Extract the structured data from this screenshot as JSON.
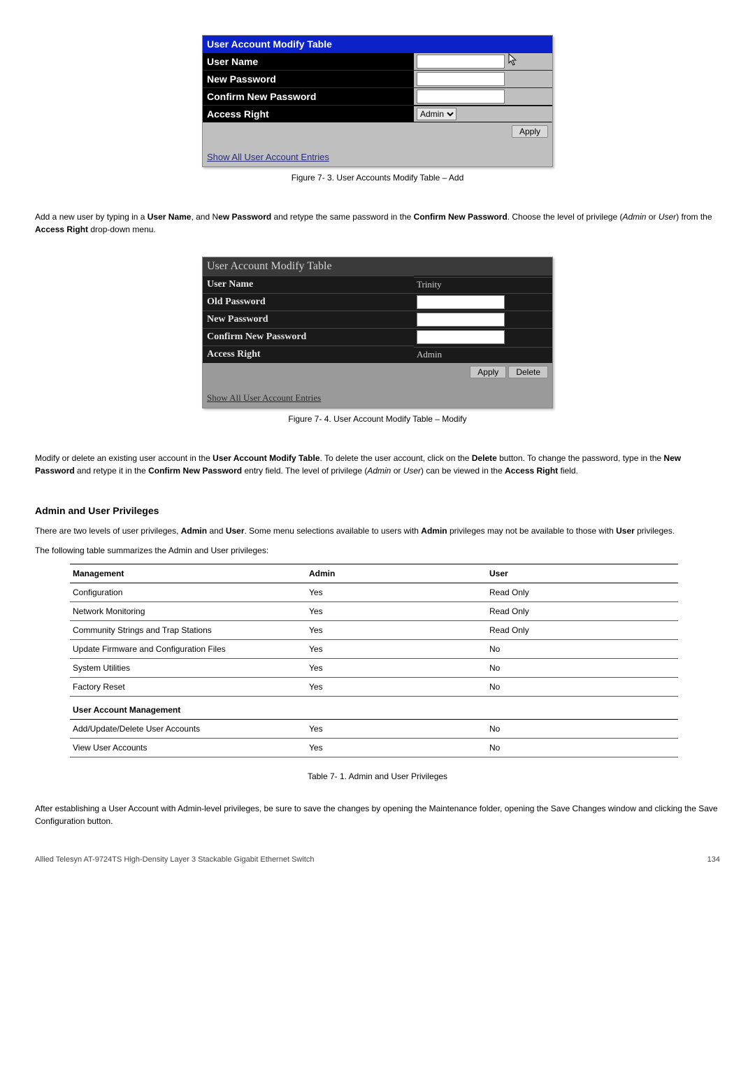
{
  "fig1": {
    "title": "User Account Modify Table",
    "labels": {
      "user_name": "User Name",
      "new_password": "New Password",
      "confirm_new_password": "Confirm New Password",
      "access_right": "Access Right"
    },
    "access_right_value": "Admin",
    "apply": "Apply",
    "link": "Show All User Account Entries",
    "caption": "Figure 7- 3. User Accounts Modify Table – Add"
  },
  "para1": {
    "a": "Add a new user by typing in a ",
    "b": "User Name",
    "c": ", and N",
    "d": "ew Password",
    "e": " and retype the same password in the ",
    "f": "Confirm New Password",
    "g": ". Choose the level of privilege (",
    "h": "Admin",
    "i": " or ",
    "j": "User",
    "k": ") from the ",
    "l": "Access Right",
    "m": " drop-down menu."
  },
  "fig2": {
    "title": "User Account Modify Table",
    "labels": {
      "user_name": "User Name",
      "old_password": "Old Password",
      "new_password": "New Password",
      "confirm_new_password": "Confirm New Password",
      "access_right": "Access Right"
    },
    "user_name_value": "Trinity",
    "access_right_value": "Admin",
    "apply": "Apply",
    "delete": "Delete",
    "link": "Show All User Account Entries",
    "caption": "Figure 7- 4. User Account Modify Table – Modify"
  },
  "para2": {
    "a": "Modify or delete an existing user account in the ",
    "b": "User Account Modify Table",
    "c": ". To delete the user account, click on the ",
    "d": "Delete",
    "e": " button. To change the password, type in the ",
    "f": "New Password",
    "g": " and retype it in the ",
    "h": "Confirm New Password",
    "i": " entry field. The level of privilege (",
    "j": "Admin",
    "k": " or ",
    "l": "User",
    "m": ") can be viewed in the ",
    "n": "Access Right",
    "o": " field."
  },
  "section_heading": "Admin and User Privileges",
  "para3": {
    "a": "There are two levels of user privileges, ",
    "b": "Admin",
    "c": " and ",
    "d": "User",
    "e": ". Some menu selections available to users with ",
    "f": "Admin",
    "g": " privileges may not be available to those with ",
    "h": "User",
    "i": " privileges."
  },
  "para4": "The following table summarizes the Admin and User privileges:",
  "chart_data": {
    "type": "table",
    "headers": [
      "Management",
      "Admin",
      "User"
    ],
    "sections": [
      {
        "rows": [
          {
            "name": "Configuration",
            "admin": "Yes",
            "user": "Read Only"
          },
          {
            "name": "Network Monitoring",
            "admin": "Yes",
            "user": "Read Only"
          },
          {
            "name": "Community Strings and Trap Stations",
            "admin": "Yes",
            "user": "Read Only"
          },
          {
            "name": "Update Firmware and Configuration Files",
            "admin": "Yes",
            "user": "No"
          },
          {
            "name": "System Utilities",
            "admin": "Yes",
            "user": "No"
          },
          {
            "name": "Factory Reset",
            "admin": "Yes",
            "user": "No"
          }
        ]
      },
      {
        "heading": "User Account Management",
        "rows": [
          {
            "name": "Add/Update/Delete User Accounts",
            "admin": "Yes",
            "user": "No"
          },
          {
            "name": "View User Accounts",
            "admin": "Yes",
            "user": "No"
          }
        ]
      }
    ],
    "caption": "Table 7- 1. Admin and User Privileges"
  },
  "para5": "After establishing a User Account with Admin-level privileges, be sure to save the changes by opening the Maintenance folder, opening the Save Changes window and clicking the Save Configuration button.",
  "footer": {
    "left": "Allied Telesyn AT-9724TS High-Density Layer 3 Stackable Gigabit Ethernet Switch",
    "right": "134"
  }
}
